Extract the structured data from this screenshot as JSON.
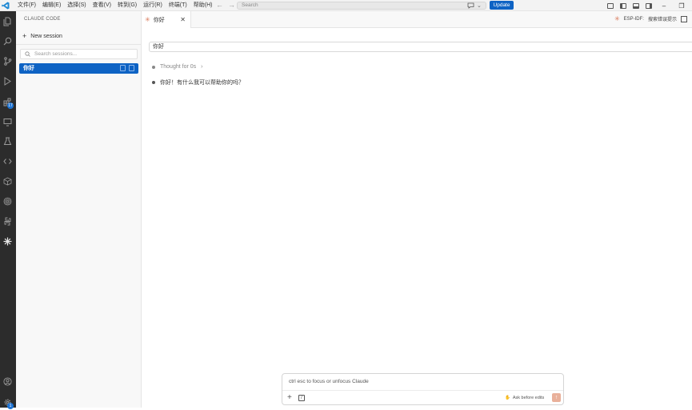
{
  "menu": [
    "文件(F)",
    "编辑(E)",
    "选择(S)",
    "查看(V)",
    "转到(G)",
    "运行(R)",
    "终端(T)",
    "帮助(H)"
  ],
  "titlebar": {
    "search_placeholder": "Search",
    "update_label": "Update",
    "restore_glyph": "❐"
  },
  "activity_bar": {
    "extensions_badge": "17",
    "settings_badge": "1"
  },
  "sidebar": {
    "title": "CLAUDE CODE",
    "new_session_label": "New session",
    "search_placeholder": "Search sessions...",
    "sessions": [
      {
        "label": "你好",
        "selected": true
      }
    ]
  },
  "tab": {
    "label": "你好",
    "close_glyph": "✕"
  },
  "tab_right": {
    "esp_idf_label": "ESP-IDF:",
    "hint_label": "搜索错误提示"
  },
  "conversation": {
    "user_prompt": "你好",
    "thought_label": "Thought for 0s",
    "thought_chevron": "›",
    "reply": "你好！有什么我可以帮助你的吗？"
  },
  "composer": {
    "placeholder": "ctrl esc to focus or unfocus Claude",
    "mode_label": "Ask before edits",
    "add_glyph": "+",
    "slash_glyph": "/",
    "send_glyph": "↑"
  },
  "colors": {
    "accent": "#0e63c4",
    "claude": "#d97757",
    "activity_bg": "#2c2c2c",
    "thought_dot": "#888888",
    "reply_dot": "#555555"
  }
}
